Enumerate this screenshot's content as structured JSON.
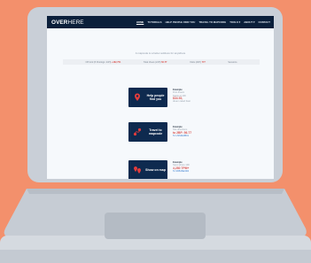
{
  "nav": {
    "logo_bold": "OVER",
    "logo_light": "HERE",
    "links": [
      "HOME",
      "TUTORIALS",
      "HELP PEOPLE FIND YOU",
      "TRAVEL TO MAPCODE",
      "TOOLS ▾",
      "ABOUT ▾",
      "CONTACT"
    ]
  },
  "tagline": "A mapcode is a better address for anywhere",
  "stats": {
    "label1": "Off Grid (5 Postings: 24H)",
    "num1": "+182,751",
    "label2": "Total Views (24H)",
    "num2": "56.7T",
    "label3": "Visits (24H)",
    "num3": "777",
    "label4": "Sessions"
  },
  "cards": [
    {
      "label": "Help people find you",
      "icon": "person-pin-icon",
      "info_title": "Example",
      "info_lines": [
        "First dream",
        "Starts at 100"
      ],
      "info_big": "$34.92,",
      "info_tail": "dream rated Fast"
    },
    {
      "label": "Travel to mapcode",
      "icon": "route-icon",
      "info_title": "Example",
      "info_lines": [
        "Site directions"
      ],
      "info_big": "to 2BF: 56.77",
      "info_tail": "To USS3E3B01"
    },
    {
      "label": "Show on map",
      "icon": "map-pins-icon",
      "info_title": "Example",
      "info_lines": [
        "Save where 100"
      ],
      "info_big": "4,280 7PM+",
      "info_tail": "To 9XB4SE3R4"
    }
  ],
  "colors": {
    "background": "#f3906c",
    "nav": "#0b1f3a",
    "card": "#0e2a4f",
    "accent": "#d9534f"
  }
}
